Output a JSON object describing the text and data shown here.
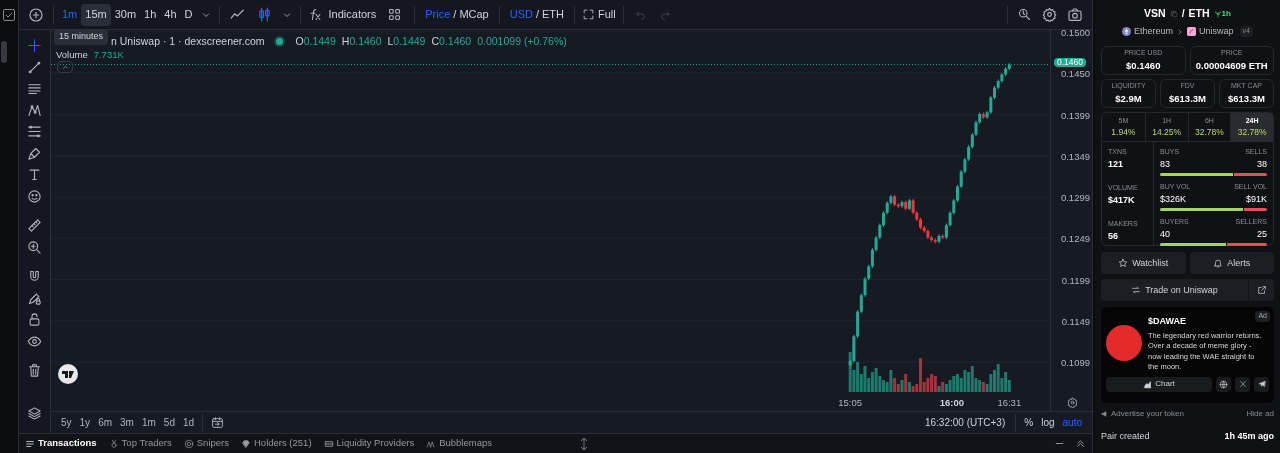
{
  "toolbar": {
    "intervals": [
      {
        "label": "1m",
        "selected": true,
        "hovered": false
      },
      {
        "label": "15m",
        "selected": false,
        "hovered": true
      },
      {
        "label": "30m",
        "selected": false,
        "hovered": false
      },
      {
        "label": "1h",
        "selected": false,
        "hovered": false
      },
      {
        "label": "4h",
        "selected": false,
        "hovered": false
      },
      {
        "label": "D",
        "selected": false,
        "hovered": false
      }
    ],
    "chart_styles": [
      {
        "selected": false
      },
      {
        "selected": true
      }
    ],
    "indicators": "Indicators",
    "price_toggle": {
      "separator": "/",
      "options": [
        {
          "label": "Price",
          "selected": true
        },
        {
          "label": "MCap",
          "selected": false
        }
      ]
    },
    "currency_toggle": {
      "separator": "/",
      "options": [
        {
          "label": "USD",
          "selected": true
        },
        {
          "label": "ETH",
          "selected": false
        }
      ]
    },
    "fullscreen": "Full",
    "undo": {
      "disabled": true
    },
    "redo": {
      "disabled": true
    }
  },
  "tooltip": "15 minutes",
  "legend": {
    "title": "n Uniswap · 1 · dexscreener.com",
    "ohlc": [
      {
        "key": "O",
        "value": "0.1449"
      },
      {
        "key": "H",
        "value": "0.1460"
      },
      {
        "key": "L",
        "value": "0.1449"
      },
      {
        "key": "C",
        "value": "0.1460"
      }
    ],
    "change": "0.001099 (+0.76%)",
    "volume_label": "Volume",
    "volume_value": "7.731K"
  },
  "drawing_tools": [
    {
      "selected": true
    },
    {
      "selected": false
    },
    {
      "selected": false
    },
    {
      "selected": false
    },
    {
      "selected": false
    },
    {
      "selected": false
    },
    {
      "selected": false
    },
    {
      "selected": false
    },
    {
      "selected": false
    },
    {
      "selected": false
    },
    {
      "selected": false
    },
    {
      "selected": false
    },
    {
      "selected": false
    },
    {
      "selected": false
    },
    {
      "selected": false
    }
  ],
  "chart": {
    "chart_data": {
      "type": "candlestick",
      "x": [
        905,
        907,
        909,
        911,
        913,
        915,
        917,
        919,
        921,
        923,
        925,
        927,
        929,
        931,
        933,
        935,
        937,
        939,
        941,
        943,
        945,
        947,
        949,
        951,
        953,
        955,
        957,
        959,
        961,
        963,
        965,
        967,
        969,
        971,
        973,
        975,
        977,
        979,
        981,
        983,
        985,
        987,
        989,
        991
      ],
      "ohlc": [
        [
          0.1095,
          0.1102,
          0.1093,
          0.11
        ],
        [
          0.11,
          0.1132,
          0.1098,
          0.113
        ],
        [
          0.113,
          0.1162,
          0.1128,
          0.116
        ],
        [
          0.116,
          0.1182,
          0.1158,
          0.118
        ],
        [
          0.118,
          0.1202,
          0.1178,
          0.12
        ],
        [
          0.12,
          0.1217,
          0.1198,
          0.1215
        ],
        [
          0.1215,
          0.1237,
          0.1213,
          0.1235
        ],
        [
          0.1235,
          0.1252,
          0.1233,
          0.125
        ],
        [
          0.125,
          0.1267,
          0.1248,
          0.1265
        ],
        [
          0.1265,
          0.1282,
          0.1263,
          0.128
        ],
        [
          0.128,
          0.1294,
          0.1278,
          0.1292
        ],
        [
          0.1292,
          0.1302,
          0.129,
          0.13
        ],
        [
          0.13,
          0.1302,
          0.1288,
          0.129
        ],
        [
          0.129,
          0.1292,
          0.1286,
          0.1288
        ],
        [
          0.1288,
          0.1295,
          0.1286,
          0.1293
        ],
        [
          0.1293,
          0.1295,
          0.1283,
          0.1285
        ],
        [
          0.1285,
          0.1297,
          0.1283,
          0.1295
        ],
        [
          0.1295,
          0.1297,
          0.1278,
          0.128
        ],
        [
          0.128,
          0.1282,
          0.127,
          0.1272
        ],
        [
          0.1272,
          0.1274,
          0.126,
          0.1262
        ],
        [
          0.1262,
          0.1264,
          0.1256,
          0.1258
        ],
        [
          0.1258,
          0.126,
          0.1248,
          0.125
        ],
        [
          0.125,
          0.1252,
          0.1245,
          0.1247
        ],
        [
          0.1247,
          0.1249,
          0.1243,
          0.1245
        ],
        [
          0.1245,
          0.1254,
          0.1243,
          0.1252
        ],
        [
          0.1252,
          0.1254,
          0.1248,
          0.125
        ],
        [
          0.125,
          0.1267,
          0.1248,
          0.1265
        ],
        [
          0.1265,
          0.1282,
          0.1263,
          0.128
        ],
        [
          0.128,
          0.1297,
          0.1278,
          0.1295
        ],
        [
          0.1295,
          0.1314,
          0.1293,
          0.1312
        ],
        [
          0.1312,
          0.1332,
          0.131,
          0.133
        ],
        [
          0.133,
          0.1347,
          0.1328,
          0.1345
        ],
        [
          0.1345,
          0.1362,
          0.1343,
          0.136
        ],
        [
          0.136,
          0.1377,
          0.1358,
          0.1375
        ],
        [
          0.1375,
          0.1392,
          0.1373,
          0.139
        ],
        [
          0.139,
          0.1402,
          0.1388,
          0.14
        ],
        [
          0.14,
          0.1402,
          0.1394,
          0.1396
        ],
        [
          0.1396,
          0.1404,
          0.1394,
          0.1402
        ],
        [
          0.1402,
          0.1422,
          0.14,
          0.142
        ],
        [
          0.142,
          0.1434,
          0.1418,
          0.1432
        ],
        [
          0.1432,
          0.1442,
          0.143,
          0.144
        ],
        [
          0.144,
          0.145,
          0.1438,
          0.1448
        ],
        [
          0.1448,
          0.1457,
          0.1446,
          0.1455
        ],
        [
          0.1455,
          0.1462,
          0.1453,
          0.146
        ]
      ],
      "xlim": [
        473,
        1013
      ],
      "ylim": [
        0.106,
        0.1502
      ],
      "grid": true,
      "ref_lines": [
        {
          "axis": "y",
          "value": 0.146,
          "label": "0.1460"
        }
      ],
      "xticks": [
        {
          "value": 905,
          "label": "15:05"
        },
        {
          "value": 960,
          "label": "16:00"
        },
        {
          "value": 991,
          "label": "16:31"
        }
      ],
      "yticks": [
        {
          "value": 0.15,
          "label": "0.1500"
        },
        {
          "value": 0.145,
          "label": "0.1450"
        },
        {
          "value": 0.1399,
          "label": "0.1399"
        },
        {
          "value": 0.1349,
          "label": "0.1349"
        },
        {
          "value": 0.1299,
          "label": "0.1299"
        },
        {
          "value": 0.1249,
          "label": "0.1249"
        },
        {
          "value": 0.1199,
          "label": "0.1199"
        },
        {
          "value": 0.1149,
          "label": "0.1149"
        },
        {
          "value": 0.1099,
          "label": "0.1099"
        }
      ]
    }
  },
  "range_bar": {
    "ranges": [
      "5y",
      "1y",
      "6m",
      "3m",
      "1m",
      "5d",
      "1d"
    ],
    "clock": "16:32:00 (UTC+3)",
    "options": [
      {
        "label": "%",
        "on": false
      },
      {
        "label": "log",
        "on": false
      },
      {
        "label": "auto",
        "on": true
      }
    ]
  },
  "bottom_tabs": [
    {
      "label": "Transactions",
      "selected": true
    },
    {
      "label": "Top Traders",
      "selected": false
    },
    {
      "label": "Snipers",
      "selected": false
    },
    {
      "label": "Holders (251)",
      "selected": false
    },
    {
      "label": "Liquidity Providers",
      "selected": false
    },
    {
      "label": "Bubblemaps",
      "selected": false
    }
  ],
  "pair": {
    "base": "VSN",
    "separator": "/",
    "quote": "ETH",
    "age": "1h",
    "chain": "Ethereum",
    "dex": "Uniswap",
    "version": "v4"
  },
  "price_cards": [
    {
      "label": "PRICE USD",
      "value": "$0.1460"
    },
    {
      "label": "PRICE",
      "value": "0.00004609 ETH"
    }
  ],
  "metric_cards": [
    {
      "label": "LIQUIDITY",
      "value": "$2.9M"
    },
    {
      "label": "FDV",
      "value": "$613.3M"
    },
    {
      "label": "MKT CAP",
      "value": "$613.3M"
    }
  ],
  "timeframes": [
    {
      "label": "5M",
      "change": "1.94%",
      "selected": false
    },
    {
      "label": "1H",
      "change": "14.25%",
      "selected": false
    },
    {
      "label": "6H",
      "change": "32.78%",
      "selected": false
    },
    {
      "label": "24H",
      "change": "32.78%",
      "selected": true
    }
  ],
  "stats": [
    {
      "label": "TXNS",
      "value": "121"
    },
    {
      "label": "VOLUME",
      "value": "$417K"
    },
    {
      "label": "MAKERS",
      "value": "56"
    }
  ],
  "splits": [
    {
      "left_label": "BUYS",
      "left_value": "83",
      "right_label": "SELLS",
      "right_value": "38",
      "level": 0.686
    },
    {
      "left_label": "BUY VOL",
      "left_value": "$326K",
      "right_label": "SELL VOL",
      "right_value": "$91K",
      "level": 0.78
    },
    {
      "left_label": "BUYERS",
      "left_value": "40",
      "right_label": "SELLERS",
      "right_value": "25",
      "level": 0.615
    }
  ],
  "actions": {
    "watchlist": "Watchlist",
    "alerts": "Alerts",
    "trade": "Trade on Uniswap"
  },
  "ad": {
    "title": "$DAWAE",
    "badge": "Ad",
    "text": "The legendary red warrior returns. Over a decade of meme glory - now leading the WAE straight to the moon.",
    "chart_button": "Chart",
    "advertise": "Advertise your token",
    "hide": "Hide ad"
  },
  "pair_created": {
    "label": "Pair created",
    "value": "1h 45m ago"
  }
}
